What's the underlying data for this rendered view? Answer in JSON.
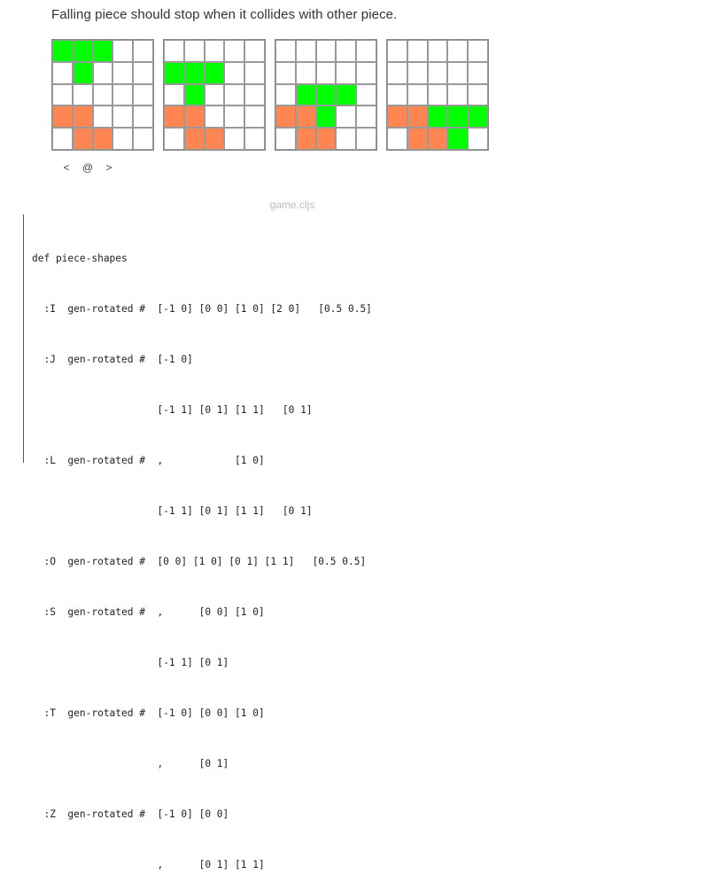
{
  "heading": "Falling piece should stop when it collides with other piece.",
  "nav": {
    "prev": "<",
    "reset": "@",
    "next": ">"
  },
  "filename": "game.cljs",
  "grids": [
    {
      "rows": [
        "GGG..",
        ".G...",
        ".....",
        "OO...",
        ".OO.."
      ]
    },
    {
      "rows": [
        ".....",
        "GGG..",
        ".G...",
        "OO...",
        ".OO.."
      ]
    },
    {
      "rows": [
        ".....",
        ".....",
        ".GGG.",
        "OOG..",
        ".OO.."
      ]
    },
    {
      "rows": [
        ".....",
        ".....",
        ".....",
        "OOGGG",
        ".OOG."
      ]
    }
  ],
  "code": [
    "def piece-shapes",
    "  :I  gen-rotated #  [-1 0] [0 0] [1 0] [2 0]   [0.5 0.5]",
    "  :J  gen-rotated #  [-1 0]",
    "                     [-1 1] [0 1] [1 1]   [0 1]",
    "  :L  gen-rotated #  ,            [1 0]",
    "                     [-1 1] [0 1] [1 1]   [0 1]",
    "  :O  gen-rotated #  [0 0] [1 0] [0 1] [1 1]   [0.5 0.5]",
    "  :S  gen-rotated #  ,      [0 0] [1 0]",
    "                     [-1 1] [0 1]",
    "  :T  gen-rotated #  [-1 0] [0 0] [1 0]",
    "                     ,      [0 1]",
    "  :Z  gen-rotated #  [-1 0] [0 0]",
    "                     ,      [0 1] [1 1]"
  ]
}
